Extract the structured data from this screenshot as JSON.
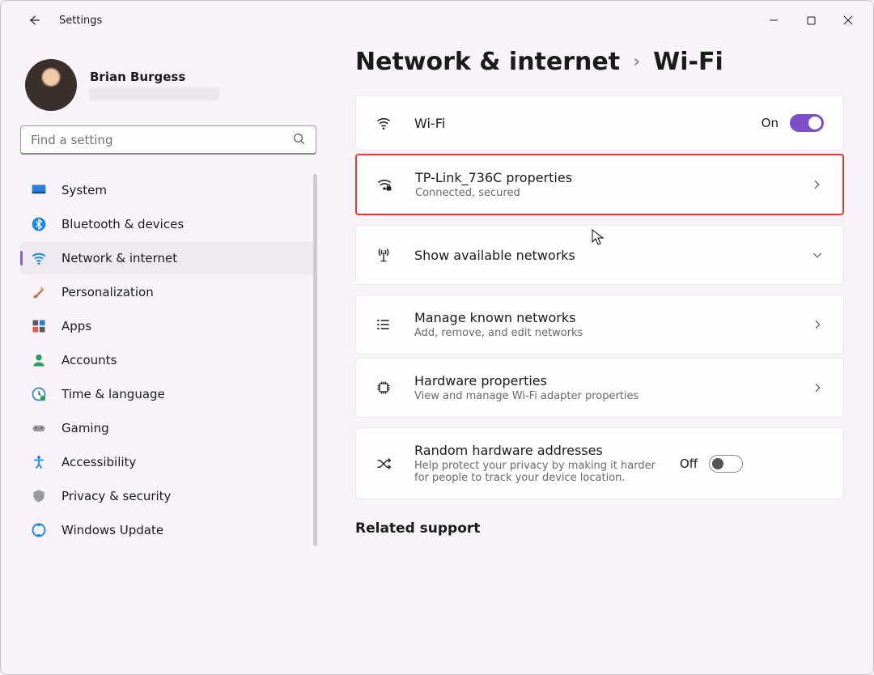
{
  "app": {
    "title": "Settings"
  },
  "profile": {
    "name": "Brian Burgess"
  },
  "search": {
    "placeholder": "Find a setting"
  },
  "sidebar": {
    "items": [
      {
        "label": "System"
      },
      {
        "label": "Bluetooth & devices"
      },
      {
        "label": "Network & internet"
      },
      {
        "label": "Personalization"
      },
      {
        "label": "Apps"
      },
      {
        "label": "Accounts"
      },
      {
        "label": "Time & language"
      },
      {
        "label": "Gaming"
      },
      {
        "label": "Accessibility"
      },
      {
        "label": "Privacy & security"
      },
      {
        "label": "Windows Update"
      }
    ]
  },
  "breadcrumb": {
    "parent": "Network & internet",
    "current": "Wi-Fi"
  },
  "cards": {
    "wifi": {
      "title": "Wi-Fi",
      "state": "On"
    },
    "network": {
      "title": "TP-Link_736C properties",
      "sub": "Connected, secured"
    },
    "available": {
      "title": "Show available networks"
    },
    "known": {
      "title": "Manage known networks",
      "sub": "Add, remove, and edit networks"
    },
    "hardware": {
      "title": "Hardware properties",
      "sub": "View and manage Wi-Fi adapter properties"
    },
    "random": {
      "title": "Random hardware addresses",
      "sub": "Help protect your privacy by making it harder for people to track your device location.",
      "state": "Off"
    }
  },
  "related": {
    "heading": "Related support"
  }
}
